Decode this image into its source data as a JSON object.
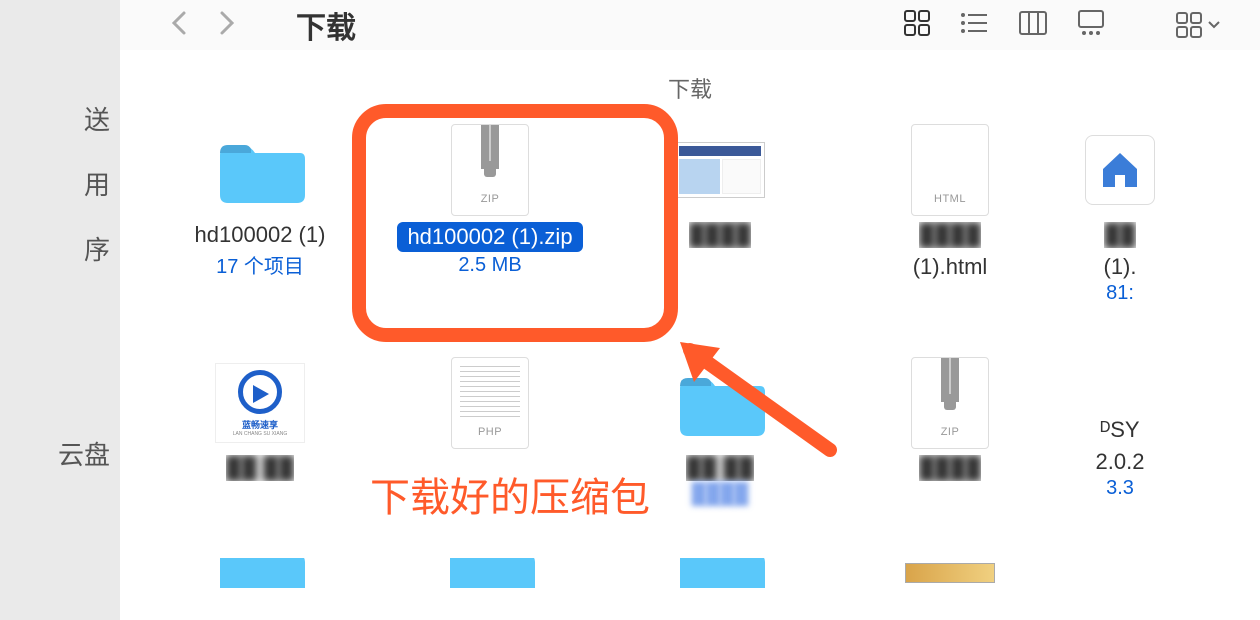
{
  "toolbar": {
    "title": "下载",
    "subheader": "下载"
  },
  "sidebar": {
    "items": [
      "送",
      "用",
      "序",
      "云盘"
    ]
  },
  "files": [
    {
      "name": "hd100002 (1)",
      "sub": "17 个项目",
      "icon": "folder"
    },
    {
      "name": "hd100002 (1).zip",
      "sub": "2.5 MB",
      "icon": "zip",
      "selected": true
    },
    {
      "name": "",
      "sub": "",
      "icon": "thumb",
      "blurred": true
    },
    {
      "name": "(1).html",
      "sub": "",
      "icon": "html",
      "blurred_top": true
    },
    {
      "name": "(1).",
      "sub": "81:",
      "icon": "house",
      "blurred_top": true
    },
    {
      "name": "",
      "sub": "",
      "icon": "logo",
      "blurred": true
    },
    {
      "name": "",
      "sub": "",
      "icon": "php",
      "blurred": true
    },
    {
      "name": "",
      "sub": "",
      "icon": "folder",
      "blurred": true
    },
    {
      "name": "",
      "sub": "",
      "icon": "zip",
      "blurred": true
    },
    {
      "name": "ᴰSY",
      "sub2": "2.0.2",
      "sub": "3.3",
      "icon": "none"
    },
    {
      "icon": "folder-partial"
    },
    {
      "icon": "folder-partial"
    },
    {
      "icon": "folder-partial"
    },
    {
      "icon": "photo-partial"
    }
  ],
  "icon_labels": {
    "zip": "ZIP",
    "html": "HTML",
    "php": "PHP"
  },
  "logo": {
    "text": "蓝畅速享",
    "sub": "LAN CHANG SU XIANG"
  },
  "annotation": "下载好的压缩包"
}
